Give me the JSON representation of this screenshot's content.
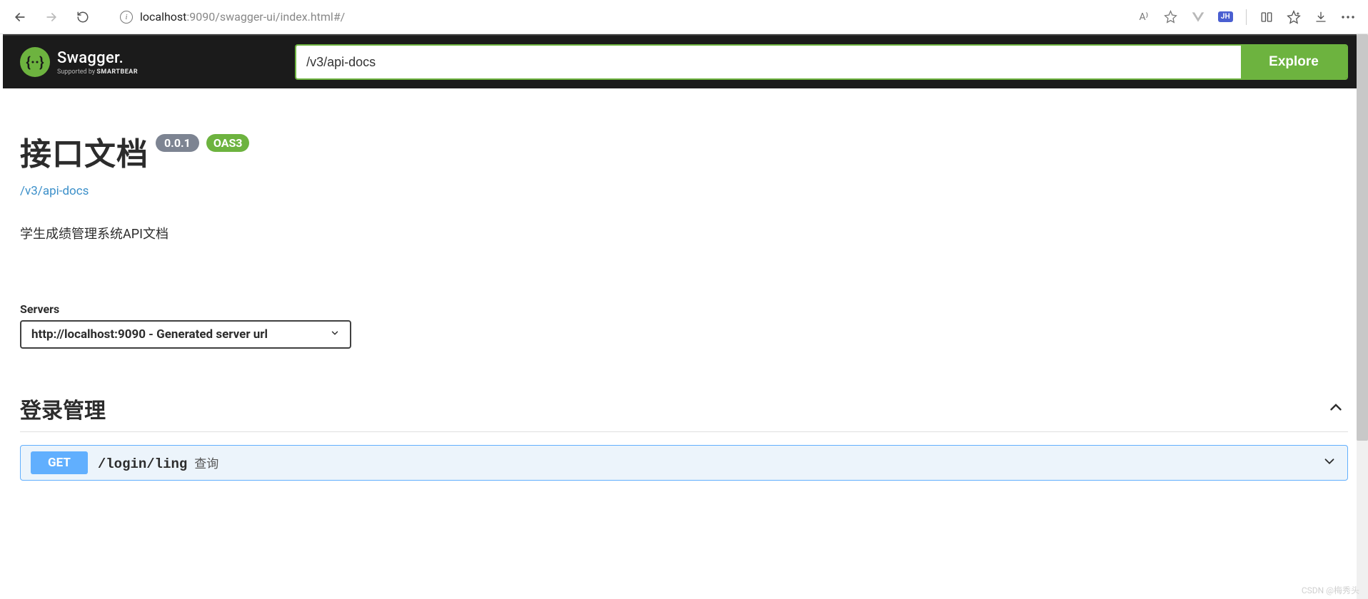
{
  "browser": {
    "url_host": "localhost",
    "url_port_path": ":9090/swagger-ui/index.html#/",
    "read_aloud": "A⁾",
    "jh_badge": "JH"
  },
  "topbar": {
    "logo_main": "Swagger.",
    "logo_sub_prefix": "Supported by ",
    "logo_sub_brand": "SMARTBEAR",
    "search_value": "/v3/api-docs",
    "explore_label": "Explore"
  },
  "info": {
    "title": "接口文档",
    "version": "0.0.1",
    "oas_label": "OAS3",
    "docs_link": "/v3/api-docs",
    "description": "学生成绩管理系统API文档"
  },
  "servers": {
    "label": "Servers",
    "selected": "http://localhost:9090 - Generated server url"
  },
  "tag": {
    "name": "登录管理"
  },
  "operation": {
    "method": "GET",
    "path": "/login/ling",
    "summary": "查询"
  },
  "watermark": "CSDN @梅秀头"
}
